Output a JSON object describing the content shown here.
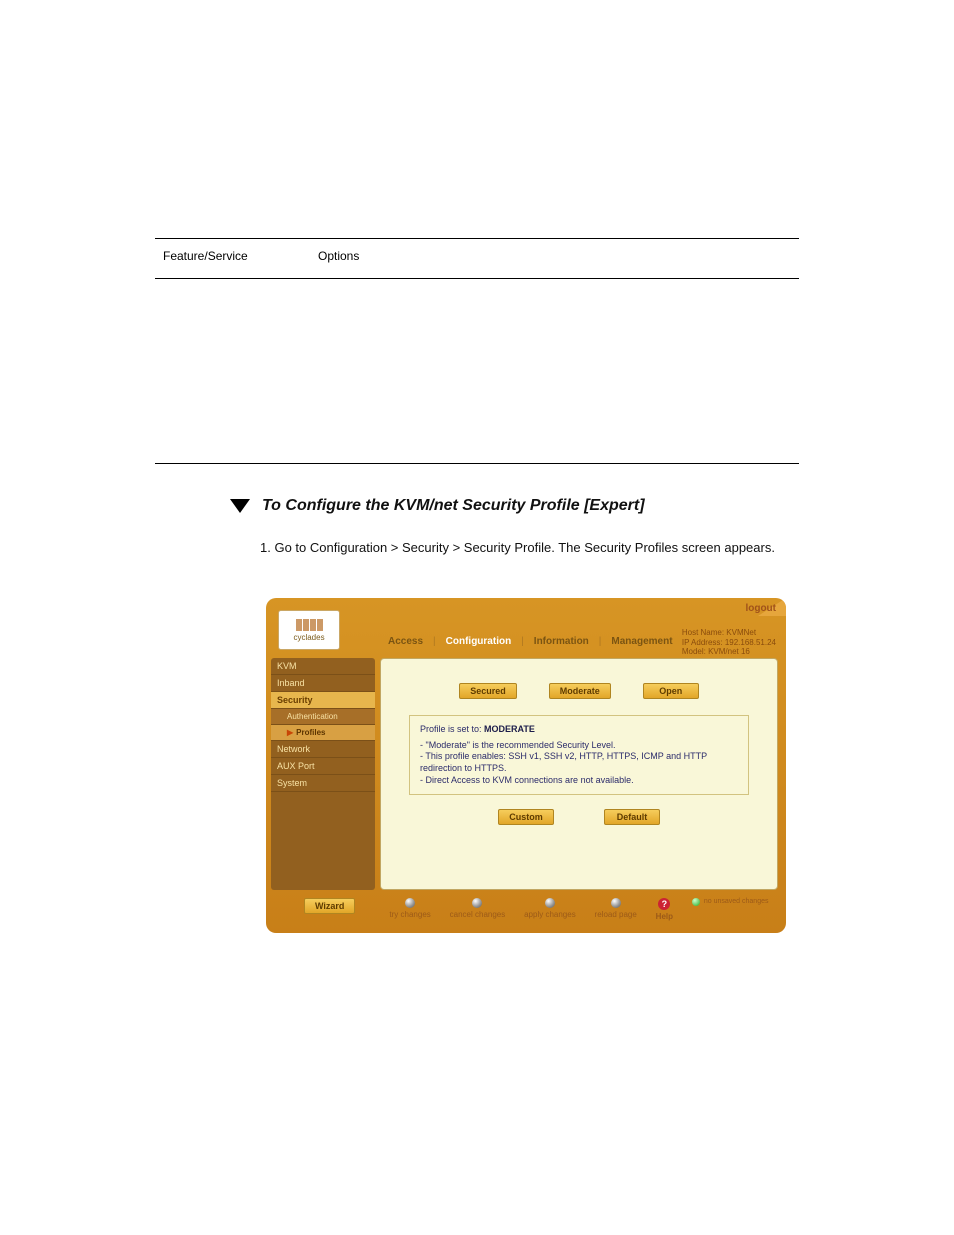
{
  "table": {
    "row1_col1": "Feature/Service",
    "row1_col2": "Options",
    "row2_col1": "",
    "row2_col2": ""
  },
  "procedure": {
    "title": "To Configure the KVM/net Security Profile [Expert]"
  },
  "step": "1. Go to Configuration > Security > Security Profile. The Security Profiles screen appears.",
  "ui": {
    "logout": "logout",
    "logo": "cyclades",
    "topnav": {
      "access": "Access",
      "configuration": "Configuration",
      "information": "Information",
      "management": "Management"
    },
    "hostinfo": {
      "line1": "Host Name: KVMNet",
      "line2": "IP Address: 192.168.51.24",
      "line3": "Model: KVM/net 16"
    },
    "sidebar": {
      "items": [
        "KVM",
        "Inband",
        "Security",
        "Authentication",
        "Profiles",
        "Network",
        "AUX Port",
        "System"
      ]
    },
    "buttons": {
      "secured": "Secured",
      "moderate": "Moderate",
      "open": "Open",
      "custom": "Custom",
      "default_btn": "Default",
      "wizard": "Wizard"
    },
    "infobox": {
      "heading_prefix": "Profile is set to:",
      "heading_value": "MODERATE",
      "b1": "\"Moderate\" is the recommended Security Level.",
      "b2": "This profile enables: SSH v1, SSH v2, HTTP, HTTPS, ICMP and HTTP redirection to HTTPS.",
      "b3": "Direct Access to KVM connections are not available."
    },
    "footer": {
      "try": "try changes",
      "cancel": "cancel changes",
      "apply": "apply changes",
      "reload": "reload page",
      "help": "Help",
      "unsaved": "no unsaved changes"
    }
  }
}
